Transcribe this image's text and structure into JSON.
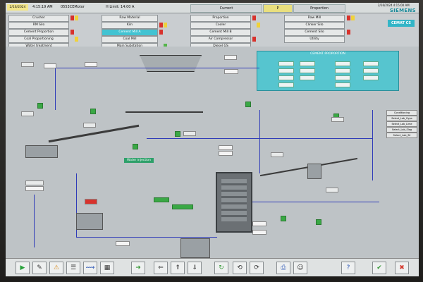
{
  "top": {
    "date": "2/16/2024",
    "time": "4:15:19 AM",
    "station": "0553CEMotor",
    "limit": "H Limit: 14:00 A",
    "current_label": "Current",
    "p_label": "P",
    "proportion_label": "Proportion",
    "right_date": "2/16/2024 4:15:00 AM",
    "brand": "SIEMENS",
    "brand_product": "CEMAT CS"
  },
  "nav": {
    "col1": [
      "Crusher",
      "RM Silo",
      "Cement Proportion",
      "Coal Proportioning",
      "Water treatment"
    ],
    "col2": [
      "Raw Material",
      "Kiln",
      "Cement Mill A",
      "Coal Mill",
      "Main Substation"
    ],
    "col3": [
      "Proportion",
      "Cooler",
      "Cement Mill B",
      "Air Compressor",
      "Diesel GS"
    ],
    "col4": [
      "Raw Mill",
      "Clinker Silo",
      "Cement Silo",
      "Utility"
    ]
  },
  "sidebar": {
    "items": [
      "Conditioning",
      "Select_Lab_Gyps",
      "Select_Lab_Lime",
      "Select_Lab_Slag",
      "Select_Lab_Sil"
    ]
  },
  "panel": {
    "title": "CEMENT PROPORTION"
  },
  "water_injection": "Water injection",
  "toolbar": {
    "buttons": [
      {
        "name": "play-icon",
        "glyph": "▶"
      },
      {
        "name": "edit-icon",
        "glyph": "✎"
      },
      {
        "name": "alarm-icon",
        "glyph": "⚠"
      },
      {
        "name": "report-icon",
        "glyph": "☰"
      },
      {
        "name": "trend-icon",
        "glyph": "⟿"
      },
      {
        "name": "faceplate-icon",
        "glyph": "▦"
      },
      {
        "name": "arrow-right-icon",
        "glyph": "➜"
      },
      {
        "name": "arrow-left-icon",
        "glyph": "⇐"
      },
      {
        "name": "arrow-up-icon",
        "glyph": "⇑"
      },
      {
        "name": "arrow-down-icon",
        "glyph": "⇓"
      },
      {
        "name": "refresh-icon",
        "glyph": "↻"
      },
      {
        "name": "back-icon",
        "glyph": "⟲"
      },
      {
        "name": "forward-icon",
        "glyph": "⟳"
      },
      {
        "name": "print-icon",
        "glyph": "⎙"
      },
      {
        "name": "user-icon",
        "glyph": "☺"
      },
      {
        "name": "help-icon",
        "glyph": "?"
      },
      {
        "name": "check-icon",
        "glyph": "✔"
      },
      {
        "name": "exit-icon",
        "glyph": "✖"
      }
    ]
  }
}
